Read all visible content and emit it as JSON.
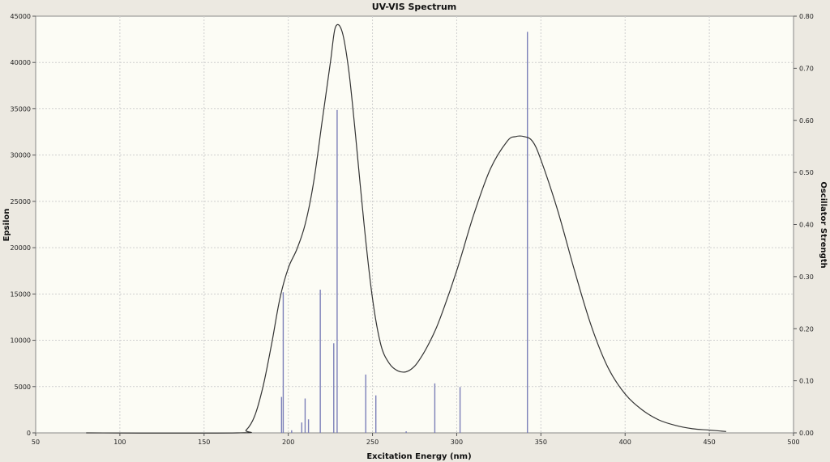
{
  "chart_data": {
    "type": "line",
    "title": "UV-VIS Spectrum",
    "xlabel": "Excitation Energy (nm)",
    "ylabel": "Epsilon",
    "y2label": "Oscillator Strength",
    "xlim": [
      50,
      500
    ],
    "ylim": [
      0,
      45000
    ],
    "y2lim": [
      0,
      0.8
    ],
    "xticks": [
      50,
      100,
      150,
      200,
      250,
      300,
      350,
      400,
      450,
      500
    ],
    "yticks": [
      0,
      5000,
      10000,
      15000,
      20000,
      25000,
      30000,
      35000,
      40000,
      45000
    ],
    "y2ticks": [
      "0.00",
      "0.10",
      "0.20",
      "0.30",
      "0.40",
      "0.50",
      "0.60",
      "0.70",
      "0.80"
    ],
    "grid": true,
    "series": [
      {
        "kind": "curve",
        "axis": "left",
        "color": "#333333",
        "x": [
          80,
          170,
          175,
          180,
          185,
          190,
          195,
          200,
          205,
          210,
          215,
          220,
          225,
          228,
          232,
          236,
          240,
          245,
          250,
          255,
          260,
          265,
          270,
          275,
          280,
          285,
          290,
          300,
          310,
          320,
          330,
          335,
          340,
          345,
          350,
          360,
          370,
          380,
          390,
          400,
          410,
          420,
          430,
          440,
          450,
          460
        ],
        "y": [
          0,
          0,
          300,
          1800,
          5000,
          9500,
          14500,
          17800,
          19800,
          22500,
          27000,
          33500,
          40000,
          43800,
          43300,
          39000,
          32000,
          22500,
          14500,
          9500,
          7500,
          6700,
          6600,
          7200,
          8500,
          10200,
          12300,
          17500,
          23500,
          28500,
          31500,
          32000,
          32000,
          31500,
          29500,
          24000,
          17500,
          11500,
          7000,
          4200,
          2500,
          1400,
          800,
          450,
          300,
          150
        ]
      },
      {
        "kind": "sticks",
        "axis": "right",
        "color": "#7b7fb8",
        "x": [
          196,
          197,
          202,
          208,
          210,
          212,
          219,
          227,
          229,
          246,
          252,
          270,
          287,
          302,
          342
        ],
        "y": [
          0.069,
          0.27,
          0.005,
          0.02,
          0.066,
          0.026,
          0.275,
          0.172,
          0.62,
          0.112,
          0.072,
          0.003,
          0.095,
          0.088,
          0.77
        ]
      }
    ]
  }
}
